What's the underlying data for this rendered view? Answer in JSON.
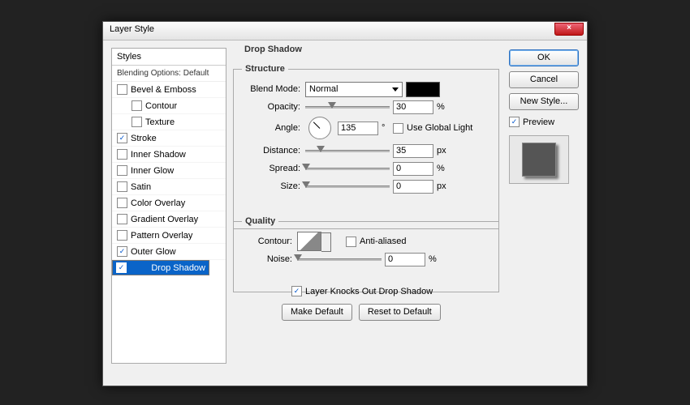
{
  "title": "Layer Style",
  "close_glyph": "×",
  "styles": {
    "header": "Styles",
    "blending": "Blending Options: Default",
    "items": [
      {
        "label": "Bevel & Emboss",
        "checked": false,
        "indent": 0
      },
      {
        "label": "Contour",
        "checked": false,
        "indent": 1
      },
      {
        "label": "Texture",
        "checked": false,
        "indent": 1
      },
      {
        "label": "Stroke",
        "checked": true,
        "indent": 0
      },
      {
        "label": "Inner Shadow",
        "checked": false,
        "indent": 0
      },
      {
        "label": "Inner Glow",
        "checked": false,
        "indent": 0
      },
      {
        "label": "Satin",
        "checked": false,
        "indent": 0
      },
      {
        "label": "Color Overlay",
        "checked": false,
        "indent": 0
      },
      {
        "label": "Gradient Overlay",
        "checked": false,
        "indent": 0
      },
      {
        "label": "Pattern Overlay",
        "checked": false,
        "indent": 0
      },
      {
        "label": "Outer Glow",
        "checked": true,
        "indent": 0
      },
      {
        "label": "Drop Shadow",
        "checked": true,
        "indent": 0,
        "selected": true
      }
    ]
  },
  "buttons": {
    "ok": "OK",
    "cancel": "Cancel",
    "newstyle": "New Style...",
    "preview": "Preview",
    "makedef": "Make Default",
    "resetdef": "Reset to Default"
  },
  "section": {
    "title": "Drop Shadow",
    "structure": "Structure",
    "quality": "Quality",
    "blend_label": "Blend Mode:",
    "blend_value": "Normal",
    "opacity_label": "Opacity:",
    "opacity_value": "30",
    "opacity_unit": "%",
    "angle_label": "Angle:",
    "angle_value": "135",
    "angle_unit": "°",
    "global_label": "Use Global Light",
    "distance_label": "Distance:",
    "distance_value": "35",
    "distance_unit": "px",
    "spread_label": "Spread:",
    "spread_value": "0",
    "spread_unit": "%",
    "size_label": "Size:",
    "size_value": "0",
    "size_unit": "px",
    "contour_label": "Contour:",
    "aa_label": "Anti-aliased",
    "noise_label": "Noise:",
    "noise_value": "0",
    "noise_unit": "%",
    "knockout": "Layer Knocks Out Drop Shadow"
  }
}
